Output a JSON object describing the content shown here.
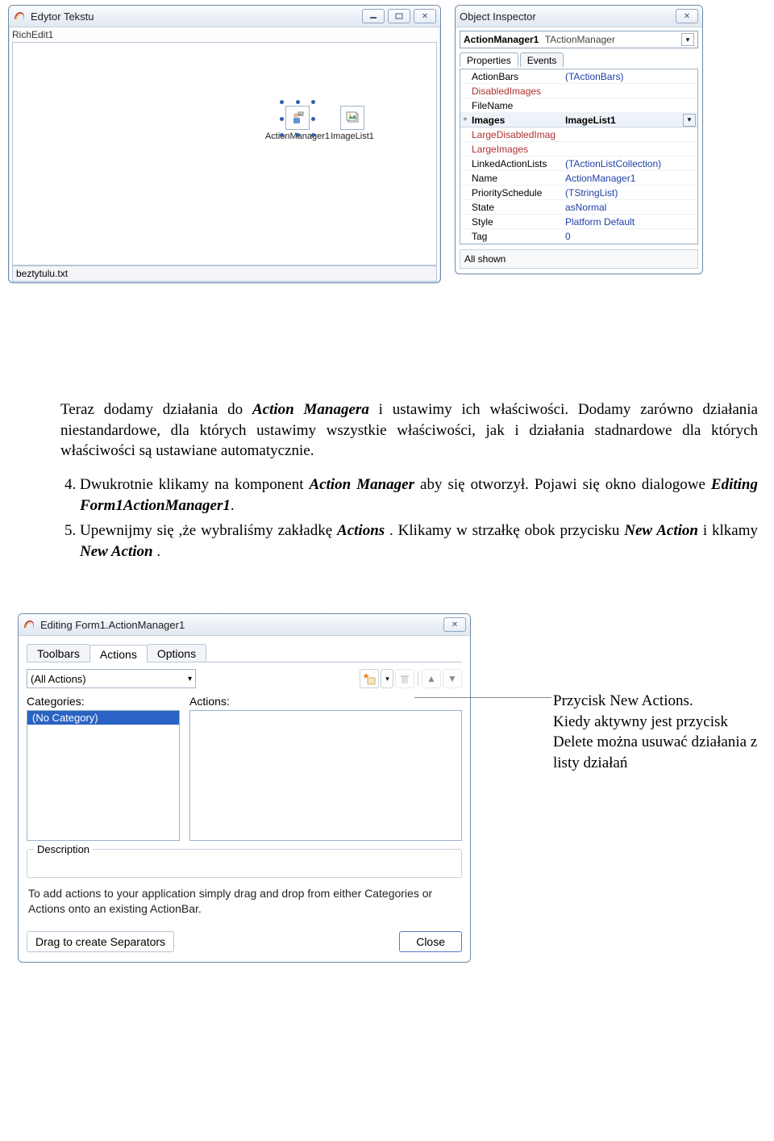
{
  "form_window": {
    "title": "Edytor Tekstu",
    "richedit_name": "RichEdit1",
    "status_text": "beztytulu.txt",
    "components": {
      "action_manager": {
        "name": "ActionManager1"
      },
      "image_list": {
        "name": "ImageList1"
      }
    }
  },
  "object_inspector": {
    "title": "Object Inspector",
    "close_glyph": "✕",
    "selector": {
      "object": "ActionManager1",
      "type": "TActionManager"
    },
    "tabs": {
      "properties": "Properties",
      "events": "Events"
    },
    "rows": [
      {
        "expand": "",
        "name": "ActionBars",
        "red": false,
        "value": "(TActionBars)"
      },
      {
        "expand": "",
        "name": "DisabledImages",
        "red": true,
        "value": ""
      },
      {
        "expand": "",
        "name": "FileName",
        "red": false,
        "value": ""
      },
      {
        "expand": "+",
        "name": "Images",
        "red": false,
        "value": "ImageList1",
        "selected": true
      },
      {
        "expand": "",
        "name": "LargeDisabledImag",
        "red": true,
        "value": ""
      },
      {
        "expand": "",
        "name": "LargeImages",
        "red": true,
        "value": ""
      },
      {
        "expand": "",
        "name": "LinkedActionLists",
        "red": false,
        "value": "(TActionListCollection)"
      },
      {
        "expand": "",
        "name": "Name",
        "red": false,
        "value": "ActionManager1"
      },
      {
        "expand": "",
        "name": "PrioritySchedule",
        "red": false,
        "value": "(TStringList)"
      },
      {
        "expand": "",
        "name": "State",
        "red": false,
        "value": "asNormal"
      },
      {
        "expand": "",
        "name": "Style",
        "red": false,
        "value": "Platform Default"
      },
      {
        "expand": "",
        "name": "Tag",
        "red": false,
        "value": "0"
      }
    ],
    "status": "All shown"
  },
  "doc": {
    "para": {
      "t1": "Teraz dodamy działania do ",
      "b1": "Action Managera",
      "t2": "  i ustawimy ich właściwości. Dodamy zarówno działania niestandardowe, dla których ustawimy wszystkie właściwości, jak i działania stadnardowe dla których właściwości są ustawiane automatycznie."
    },
    "steps": {
      "s4a": "Dwukrotnie klikamy na komponent ",
      "s4b": "Action Manager",
      "s4c": " aby się otworzył. Pojawi się okno dialogowe ",
      "s4d": "Editing Form1ActionManager1",
      "s4e": ".",
      "s5a": "Upewnijmy się ,że wybraliśmy zakładkę ",
      "s5b": "Actions",
      "s5c": " . Klikamy w strzałkę obok przycisku ",
      "s5d": "New Action",
      "s5e": " i klkamy ",
      "s5f": "New Action",
      "s5g": " ."
    }
  },
  "dialog": {
    "title": "Editing Form1.ActionManager1",
    "close_glyph": "✕",
    "tabs": {
      "toolbars": "Toolbars",
      "actions": "Actions",
      "options": "Options"
    },
    "all_actions": "(All Actions)",
    "labels": {
      "categories": "Categories:",
      "actions": "Actions:"
    },
    "category_item": "(No Category)",
    "group_label": "Description",
    "hint": "To add actions to your application simply drag and drop from either Categories or Actions onto an existing ActionBar.",
    "drag_button": "Drag to create Separators",
    "close_button": "Close"
  },
  "callout": {
    "line1a": "Przycisk ",
    "line1b": "New Actions",
    "line1c": ".",
    "line2a": "Kiedy aktywny jest przycisk ",
    "line3a": "Delete",
    "line3b": " można usuwać działania z listy działań"
  }
}
